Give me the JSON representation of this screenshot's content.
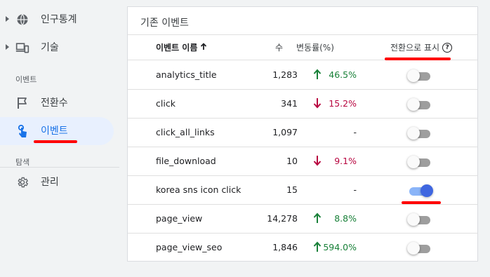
{
  "sidebar": {
    "items": [
      {
        "label": "인구통계"
      },
      {
        "label": "기술"
      },
      {
        "label": "전환수"
      },
      {
        "label": "이벤트"
      },
      {
        "label": "관리"
      }
    ],
    "section_events": "이벤트",
    "section_explore": "탐색"
  },
  "card": {
    "title": "기존 이벤트",
    "columns": {
      "name": "이벤트 이름",
      "count": "수",
      "change": "변동률(%)",
      "conversion": "전환으로 표시"
    },
    "rows": [
      {
        "name": "analytics_title",
        "count": "1,283",
        "trend": "up",
        "change": "46.5%",
        "conversion": false
      },
      {
        "name": "click",
        "count": "341",
        "trend": "down",
        "change": "15.2%",
        "conversion": false
      },
      {
        "name": "click_all_links",
        "count": "1,097",
        "trend": "none",
        "change": "-",
        "conversion": false
      },
      {
        "name": "file_download",
        "count": "10",
        "trend": "down",
        "change": "9.1%",
        "conversion": false
      },
      {
        "name": "korea sns icon click",
        "count": "15",
        "trend": "none",
        "change": "-",
        "conversion": true
      },
      {
        "name": "page_view",
        "count": "14,278",
        "trend": "up",
        "change": "8.8%",
        "conversion": false
      },
      {
        "name": "page_view_seo",
        "count": "1,846",
        "trend": "up",
        "change": "594.0%",
        "conversion": false
      }
    ]
  },
  "colors": {
    "accent": "#1a73e8",
    "up": "#188038",
    "down": "#b80640",
    "annotation": "#ff0000",
    "toggle_on": "#3f66e0"
  }
}
